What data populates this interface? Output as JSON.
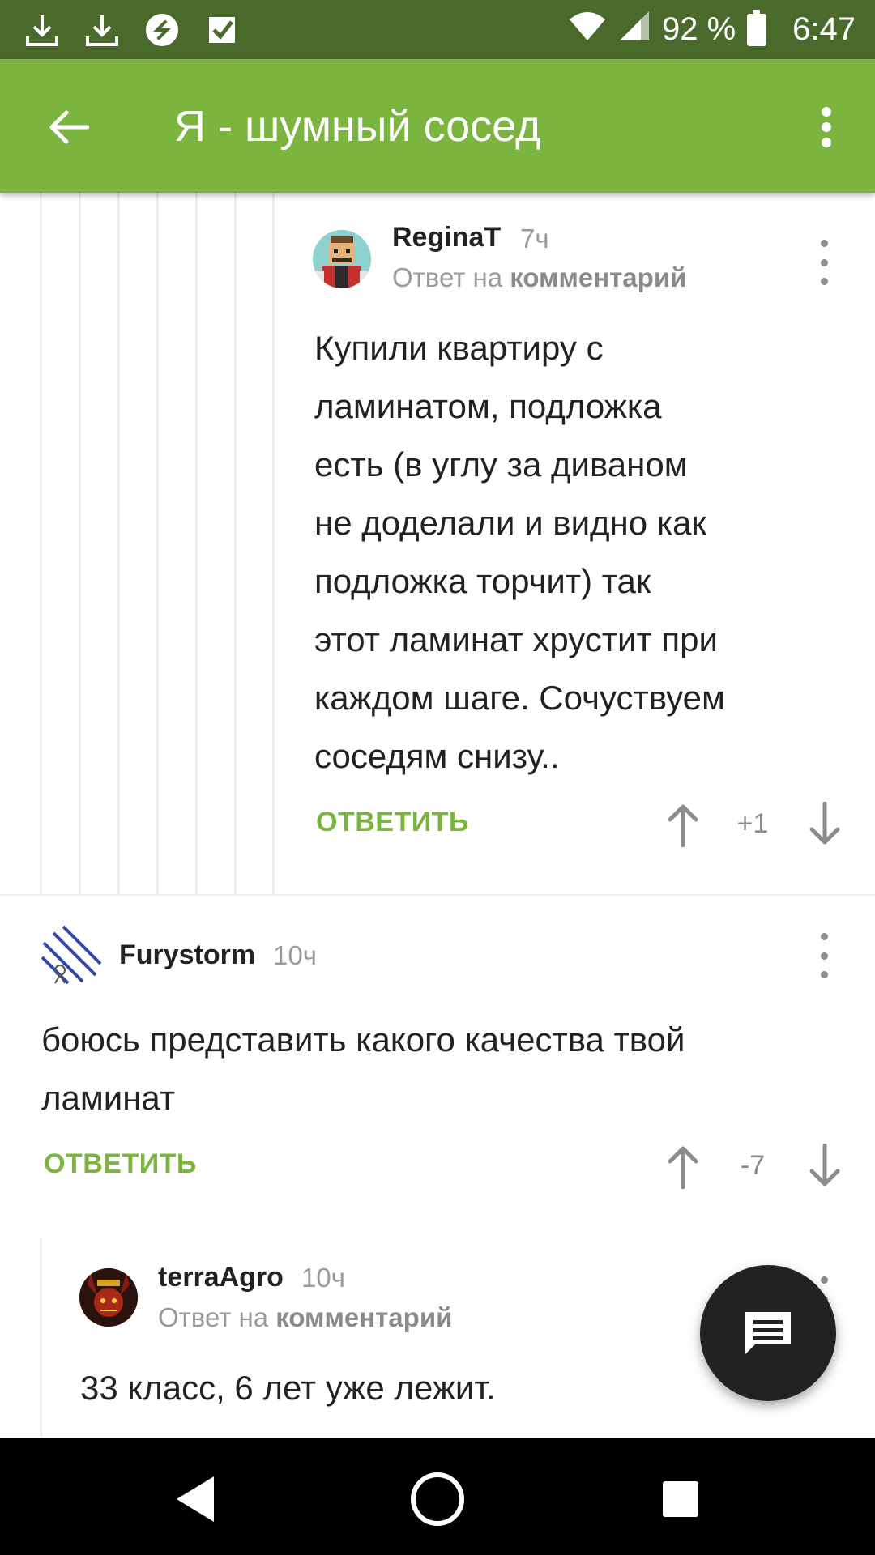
{
  "status_bar": {
    "icons": [
      "download-icon",
      "download-icon",
      "shazam-icon",
      "check-box-icon"
    ],
    "battery": "92 %",
    "time": "6:47"
  },
  "app_bar": {
    "title": "Я - шумный сосед"
  },
  "comments": [
    {
      "username": "ReginaT",
      "time": "7ч",
      "reply_prefix": "Ответ на",
      "reply_target": "комментарий",
      "lines": [
        "Купили квартиру с",
        "ламинатом, подложка",
        "есть (в углу за диваном",
        "не доделали и видно как",
        "подложка торчит) так",
        "этот ламинат хрустит при",
        "каждом шаге. Сочуствуем",
        "соседям снизу.."
      ],
      "reply_label": "ОТВЕТИТЬ",
      "score": "+1"
    },
    {
      "username": "Furystorm",
      "time": "10ч",
      "lines": [
        "боюсь представить какого качества твой",
        "ламинат"
      ],
      "reply_label": "ОТВЕТИТЬ",
      "score": "-7"
    },
    {
      "username": "terraAgro",
      "time": "10ч",
      "reply_prefix": "Ответ на",
      "reply_target": "комментарий",
      "lines": [
        "33 класс, 6 лет уже лежит."
      ]
    }
  ],
  "colors": {
    "status_bar": "#4a6a2c",
    "app_bar": "#7bb540",
    "accent": "#7bb540",
    "fab": "#222222"
  }
}
